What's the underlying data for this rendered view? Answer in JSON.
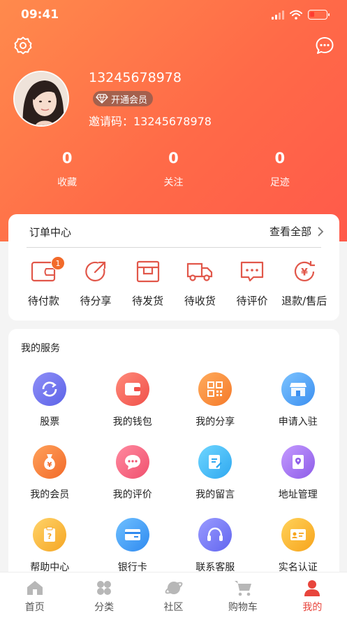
{
  "status_bar": {
    "time": "09:41"
  },
  "profile": {
    "phone": "13245678978",
    "vip_label": "开通会员",
    "invite_code": "邀请码：13245678978"
  },
  "stats": [
    {
      "value": "0",
      "label": "收藏"
    },
    {
      "value": "0",
      "label": "关注"
    },
    {
      "value": "0",
      "label": "足迹"
    }
  ],
  "orders": {
    "title": "订单中心",
    "view_all": "查看全部",
    "items": [
      {
        "label": "待付款",
        "icon": "wallet-icon",
        "badge": "1"
      },
      {
        "label": "待分享",
        "icon": "share-icon"
      },
      {
        "label": "待发货",
        "icon": "box-icon"
      },
      {
        "label": "待收货",
        "icon": "truck-icon"
      },
      {
        "label": "待评价",
        "icon": "comment-icon"
      },
      {
        "label": "退款/售后",
        "icon": "refund-icon"
      }
    ]
  },
  "services": {
    "title": "我的服务",
    "items": [
      {
        "label": "股票",
        "icon": "stock-icon"
      },
      {
        "label": "我的钱包",
        "icon": "wallet-icon"
      },
      {
        "label": "我的分享",
        "icon": "qr-icon"
      },
      {
        "label": "申请入驻",
        "icon": "store-icon"
      },
      {
        "label": "我的会员",
        "icon": "money-bag-icon"
      },
      {
        "label": "我的评价",
        "icon": "chat-bubble-icon"
      },
      {
        "label": "我的留言",
        "icon": "note-icon"
      },
      {
        "label": "地址管理",
        "icon": "address-book-icon"
      },
      {
        "label": "帮助中心",
        "icon": "help-icon"
      },
      {
        "label": "银行卡",
        "icon": "bank-card-icon"
      },
      {
        "label": "联系客服",
        "icon": "headset-icon"
      },
      {
        "label": "实名认证",
        "icon": "id-card-icon"
      }
    ]
  },
  "tabbar": [
    {
      "label": "首页",
      "icon": "home-icon",
      "active": false
    },
    {
      "label": "分类",
      "icon": "category-icon",
      "active": false
    },
    {
      "label": "社区",
      "icon": "planet-icon",
      "active": false
    },
    {
      "label": "购物车",
      "icon": "cart-icon",
      "active": false
    },
    {
      "label": "我的",
      "icon": "user-icon",
      "active": true
    }
  ],
  "colors": {
    "header_start": "#ff8a4c",
    "header_end": "#ff5a4a",
    "accent": "#e8453c",
    "badge": "#f26a2a"
  }
}
